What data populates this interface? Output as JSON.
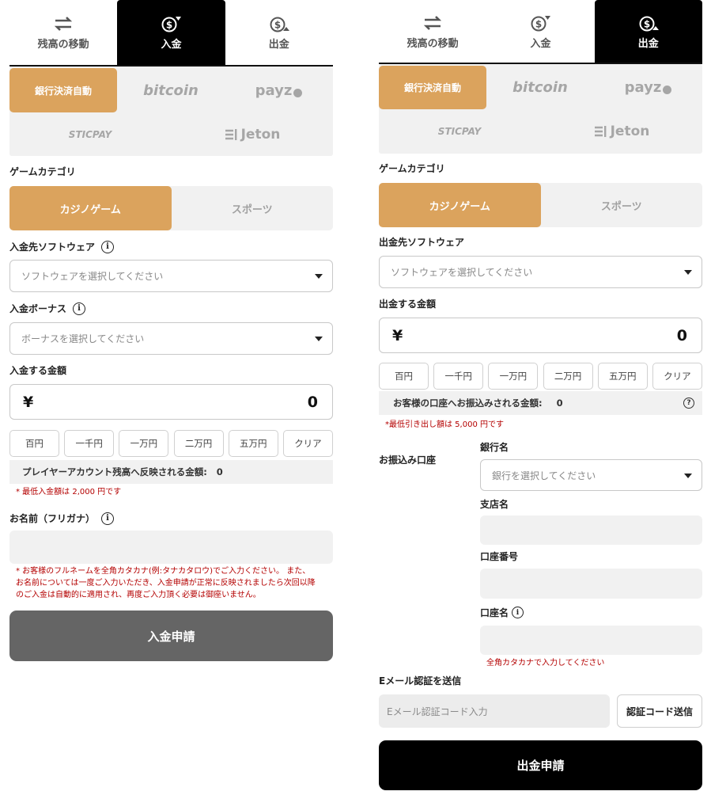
{
  "deposit": {
    "tabs": [
      "残高の移動",
      "入金",
      "出金"
    ],
    "methods": {
      "bank": "銀行決済自動",
      "bitcoin": "bitcoin",
      "payz": "payz",
      "sticpay": "STICPAY",
      "jeton": "Jeton"
    },
    "game_category_label": "ゲームカテゴリ",
    "categories": [
      "カジノゲーム",
      "スポーツ"
    ],
    "software_label": "入金先ソフトウェア",
    "software_placeholder": "ソフトウェアを選択してください",
    "bonus_label": "入金ボーナス",
    "bonus_placeholder": "ボーナスを選択してください",
    "amount_label": "入金する金額",
    "currency": "¥",
    "amount_value": "0",
    "quick_amounts": [
      "百円",
      "一千円",
      "一万円",
      "二万円",
      "五万円",
      "クリア"
    ],
    "reflect_label": "プレイヤーアカウント残高へ反映される金額:",
    "reflect_value": "0",
    "min_note": "* 最低入金額は 2,000 円です",
    "name_label": "お名前（フリガナ）",
    "name_note_1": "* お客様のフルネームを全角カタカナ(例:タナカタロウ)でご入力ください。 また、",
    "name_note_2": "お名前については一度ご入力いただき、入金申請が正常に反映されましたら次回以降",
    "name_note_3": "のご入金は自動的に適用され、再度ご入力頂く必要は御座いません。",
    "submit": "入金申請"
  },
  "withdraw": {
    "tabs": [
      "残高の移動",
      "入金",
      "出金"
    ],
    "methods": {
      "bank": "銀行決済自動",
      "bitcoin": "bitcoin",
      "payz": "payz",
      "sticpay": "STICPAY",
      "jeton": "Jeton"
    },
    "game_category_label": "ゲームカテゴリ",
    "categories": [
      "カジノゲーム",
      "スポーツ"
    ],
    "software_label": "出金先ソフトウェア",
    "software_placeholder": "ソフトウェアを選択してください",
    "amount_label": "出金する金額",
    "currency": "¥",
    "amount_value": "0",
    "quick_amounts": [
      "百円",
      "一千円",
      "一万円",
      "二万円",
      "五万円",
      "クリア"
    ],
    "transfer_label": "お客様の口座へお振込みされる金額:",
    "transfer_value": "0",
    "transfer_help": "?",
    "min_note": "*最低引き出し額は 5,000 円です",
    "account_label": "お振込み口座",
    "bank_name_label": "銀行名",
    "bank_placeholder": "銀行を選択してください",
    "branch_label": "支店名",
    "account_number_label": "口座番号",
    "account_name_label": "口座名",
    "account_name_note": "全角カタカナで入力してください",
    "email_label": "Eメール認証を送信",
    "email_placeholder": "Eメール認証コード入力",
    "email_button": "認証コード送信",
    "submit": "出金申請"
  },
  "colors": {
    "accent": "#dba35d",
    "tab_active": "#000000",
    "deposit_submit": "#656565",
    "withdraw_submit": "#000000",
    "note": "#b40000"
  }
}
